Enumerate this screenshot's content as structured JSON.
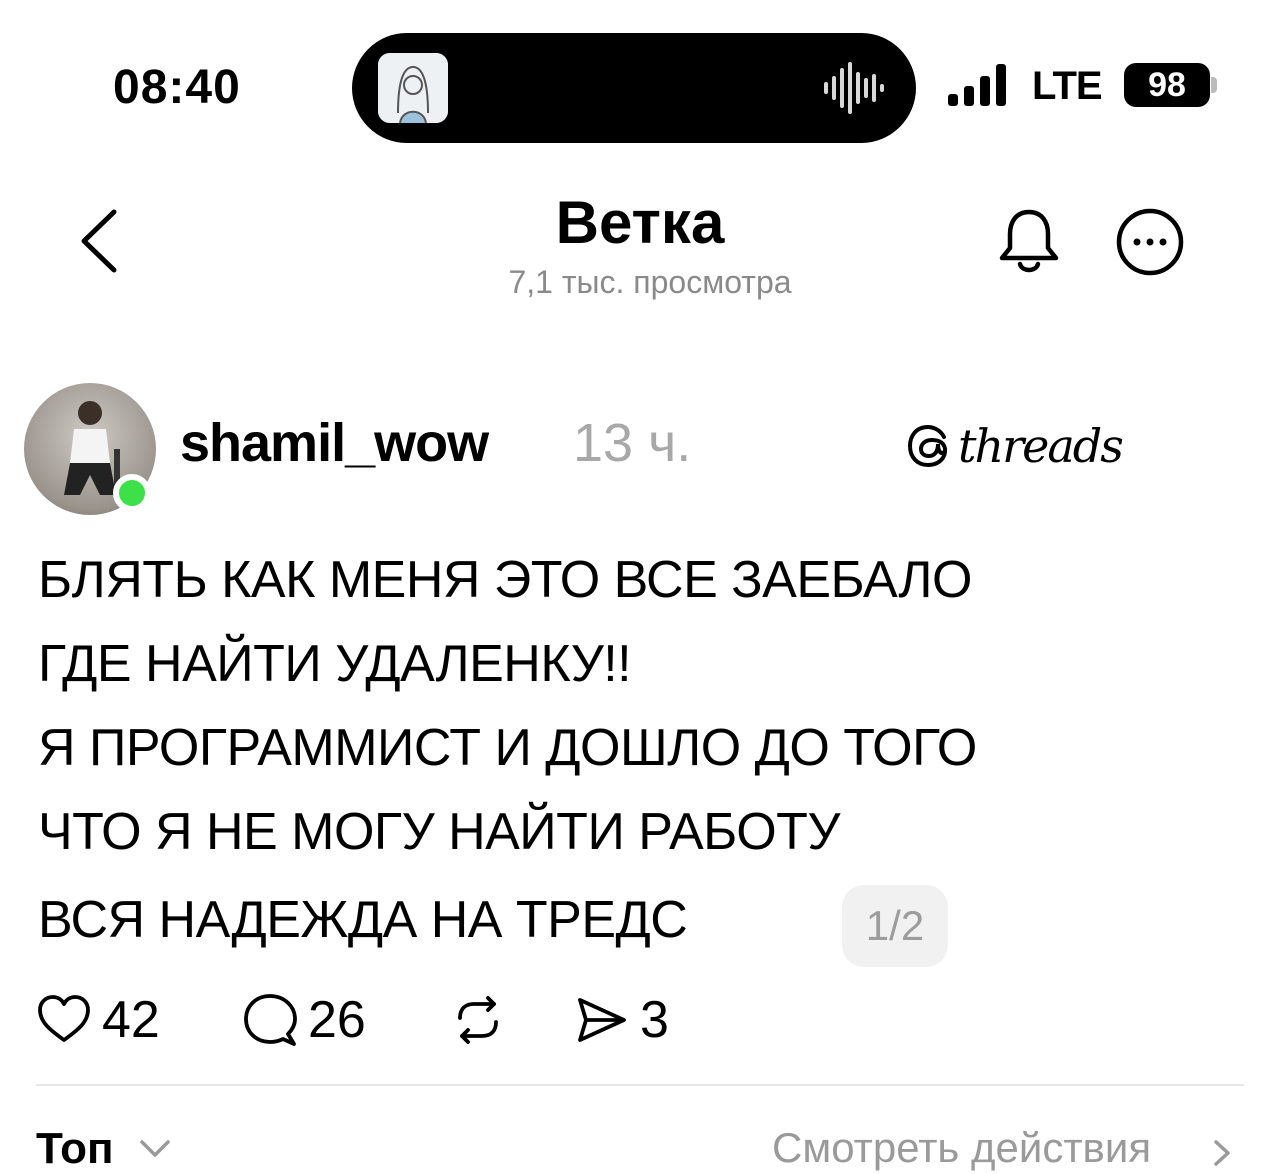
{
  "status_bar": {
    "time": "08:40",
    "network": "LTE",
    "battery": "98",
    "island_icons": [
      "contact-avatar-icon",
      "waveform-icon"
    ]
  },
  "header": {
    "title": "Ветка",
    "subtitle": "7,1 тыс. просмотра",
    "icons": [
      "back-chevron-icon",
      "bell-icon",
      "more-icon"
    ]
  },
  "post": {
    "username": "shamil_wow",
    "time": "13 ч.",
    "brand": "threads",
    "lines": [
      "БЛЯТЬ КАК МЕНЯ ЭТО ВСЕ ЗАЕБАЛО",
      "ГДЕ НАЙТИ  УДАЛЕНКУ!!",
      "Я ПРОГРАММИСТ И ДОШЛО ДО ТОГО",
      "ЧТО Я НЕ МОГУ НАЙТИ  РАБОТУ",
      "ВСЯ НАДЕЖДА НА ТРЕДС"
    ],
    "page_badge": "1/2",
    "actions": {
      "likes": "42",
      "comments": "26",
      "reposts": "",
      "shares": "3"
    }
  },
  "footer": {
    "sort_label": "Топ",
    "activity_link": "Смотреть действия"
  },
  "colors": {
    "online": "#3ee04a",
    "muted": "#8a8a8a",
    "badge_bg": "#f1f1f1"
  }
}
